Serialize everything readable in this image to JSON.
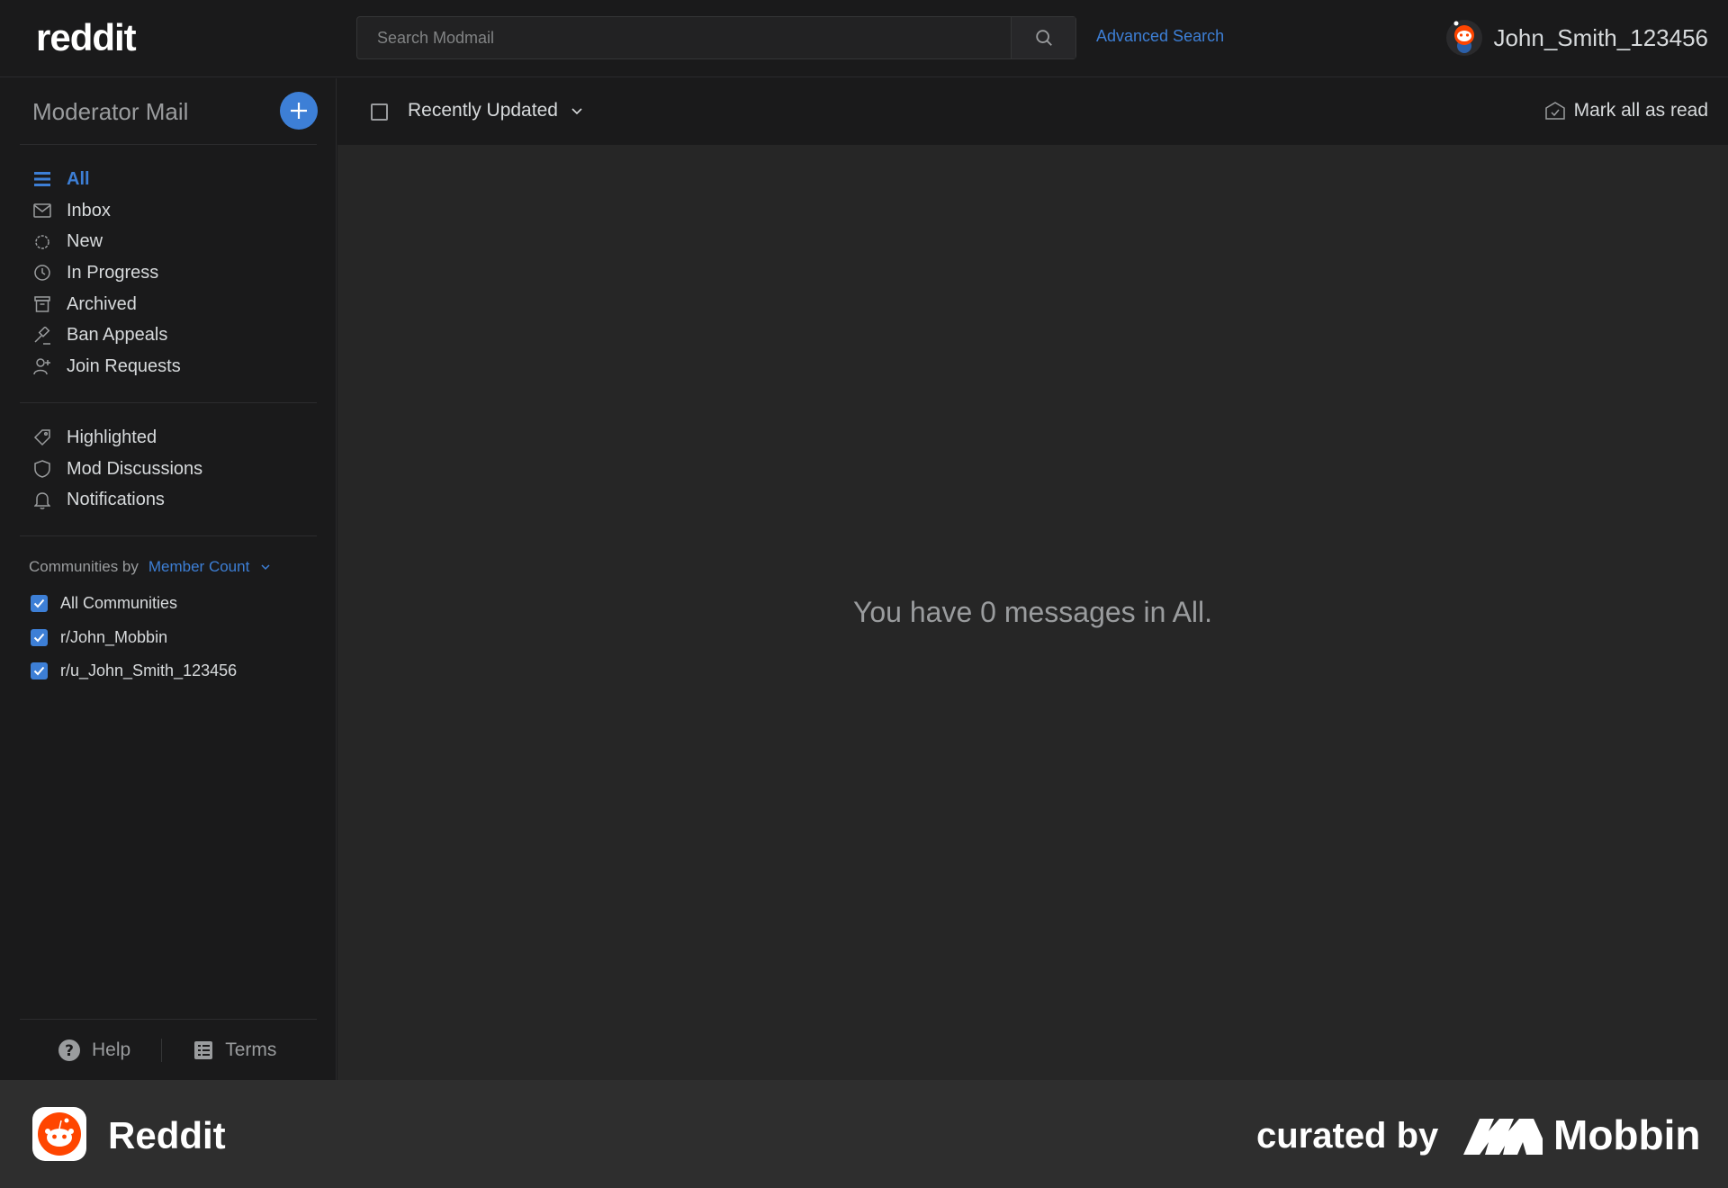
{
  "header": {
    "logo": "reddit",
    "search_placeholder": "Search Modmail",
    "advanced_search": "Advanced Search",
    "username": "John_Smith_123456"
  },
  "sidebar": {
    "title": "Moderator Mail",
    "nav": [
      {
        "label": "All",
        "icon": "list-icon",
        "active": true
      },
      {
        "label": "Inbox",
        "icon": "mail-icon"
      },
      {
        "label": "New",
        "icon": "badge-icon"
      },
      {
        "label": "In Progress",
        "icon": "clock-icon"
      },
      {
        "label": "Archived",
        "icon": "archive-icon"
      },
      {
        "label": "Ban Appeals",
        "icon": "gavel-icon"
      },
      {
        "label": "Join Requests",
        "icon": "user-add-icon"
      }
    ],
    "nav2": [
      {
        "label": "Highlighted",
        "icon": "tag-icon"
      },
      {
        "label": "Mod Discussions",
        "icon": "shield-icon"
      },
      {
        "label": "Notifications",
        "icon": "bell-icon"
      }
    ],
    "communities_by": "Communities by",
    "communities_sort": "Member Count",
    "communities": [
      {
        "label": "All Communities",
        "checked": true
      },
      {
        "label": "r/John_Mobbin",
        "checked": true
      },
      {
        "label": "r/u_John_Smith_123456",
        "checked": true
      }
    ],
    "footer": {
      "help": "Help",
      "terms": "Terms"
    }
  },
  "main": {
    "sort_label": "Recently Updated",
    "mark_all_read": "Mark all as read",
    "empty_message": "You have 0 messages in All."
  },
  "banner": {
    "app_name": "Reddit",
    "curated_by": "curated by",
    "brand": "Mobbin"
  },
  "colors": {
    "accent": "#3d7fd6",
    "background": "#1a1a1b",
    "main_bg": "#262626",
    "reddit_orange": "#ff4500"
  }
}
